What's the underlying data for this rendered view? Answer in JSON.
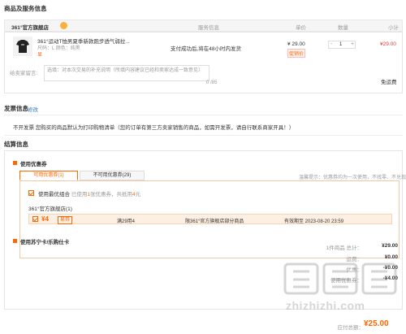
{
  "product_section": {
    "title": "商品及服务信息",
    "store_name": "361°官方旗舰店",
    "columns": {
      "service": "服务信息",
      "price": "单价",
      "qty": "数量",
      "subtotal": "小计"
    },
    "item": {
      "name": "361°运动T恤男夏季新款跑步透气弱拉...",
      "spec": "尺码：L  颜色：纯黑",
      "extra": "显",
      "service": "支付成功后,将在48小时内发货",
      "price": "¥ 29.00",
      "promo": "促销价",
      "qty": "1",
      "subtotal": "¥29.00"
    },
    "message_label": "给卖家留言:",
    "message_placeholder": "选填：对本次交易的补充说明（所填内容建议已经和卖家达成一致意见）",
    "message_count": "0 /85",
    "shipping_fee": "免运费"
  },
  "invoice_section": {
    "title": "发票信息",
    "edit_link": "修改",
    "text": "不开发票     您购买的商品默认为打印购物清单（您的订单有第三方卖家销售的商品，如需开发票，请自行联系商家开具！）"
  },
  "settlement_section": {
    "title": "结算信息",
    "coupon_title": "使用优惠券",
    "tabs": [
      "可用优惠券(1)",
      "不可用优惠券(29)"
    ],
    "hint": "温馨提示：优惠券均为一次使用，不找零、不兑现",
    "best_combo_label": "使用最优组合",
    "best_combo_prefix": "已使用",
    "best_combo_count": "1",
    "best_combo_mid": "张优惠券，共抵用",
    "best_combo_amount": "4",
    "best_combo_suffix": "元",
    "store_coupon_label": "361°官方旗舰店(1)",
    "coupon": {
      "amount": "¥4",
      "tag": "易券",
      "condition": "满29用4",
      "scope": "限361°官方旗舰店部分商品",
      "expiry": "有效期至 2023-08-20 23:59"
    },
    "card_title": "使用苏宁卡/乐购仕卡"
  },
  "summary": {
    "count_text": "1件商品 总计：",
    "total": "¥29.00",
    "shipping_label": "运费：",
    "shipping": "¥0.00",
    "discount_label": "优惠：",
    "discount": "-¥0.00",
    "coupon_label": "使用优惠券：",
    "coupon": "-¥4.00",
    "pay_label": "应付总额：",
    "pay": "¥25.00"
  },
  "watermark": "zhizhizhi.com"
}
